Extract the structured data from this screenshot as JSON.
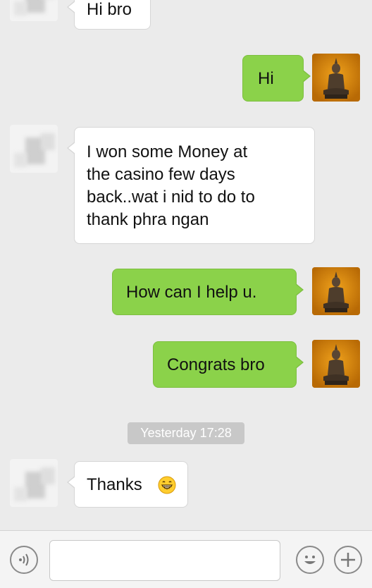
{
  "messages": [
    {
      "side": "left",
      "text": "Hi bro"
    },
    {
      "side": "right",
      "text": "Hi"
    },
    {
      "side": "left",
      "lines": [
        "I won some Money at",
        "the casino few days",
        "back..wat i nid to do to",
        "thank phra ngan"
      ]
    },
    {
      "side": "right",
      "text": "How can I help u."
    },
    {
      "side": "right",
      "text": "Congrats bro"
    },
    {
      "side": "left",
      "text": "Thanks",
      "emoji": "grinning-face-emoji"
    }
  ],
  "timestamp": "Yesterday 17:28",
  "input": {
    "value": "",
    "voice_icon": "voice-input-icon",
    "emoji_icon": "smiley-face-icon",
    "add_icon": "plus-icon"
  },
  "colors": {
    "sent_bubble": "#8bd24a",
    "received_bubble": "#ffffff",
    "background": "#ebebeb"
  }
}
